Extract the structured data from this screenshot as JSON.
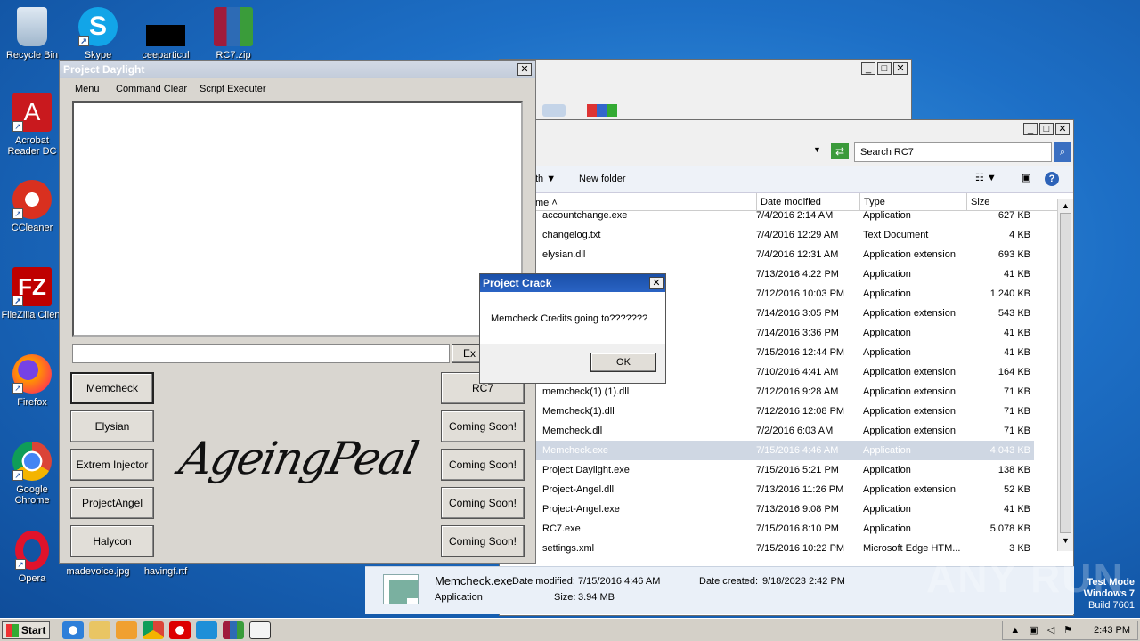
{
  "desktop_icons": [
    {
      "label": "Recycle Bin",
      "icon": "recycle-bin-icon"
    },
    {
      "label": "Skype",
      "icon": "skype-icon"
    },
    {
      "label": "ceeparticul",
      "icon": "file-icon"
    },
    {
      "label": "RC7.zip",
      "icon": "winrar-icon"
    },
    {
      "label": "Acrobat Reader DC",
      "icon": "acrobat-icon"
    },
    {
      "label": "CCleaner",
      "icon": "ccleaner-icon"
    },
    {
      "label": "FileZilla Client",
      "icon": "filezilla-icon"
    },
    {
      "label": "Firefox",
      "icon": "firefox-icon"
    },
    {
      "label": "Google Chrome",
      "icon": "chrome-icon"
    },
    {
      "label": "Opera",
      "icon": "opera-icon"
    },
    {
      "label": "madevoice.jpg",
      "icon": "image-file-icon"
    },
    {
      "label": "havingf.rtf",
      "icon": "rtf-file-icon"
    }
  ],
  "daylight": {
    "title": "Project Daylight",
    "menu": [
      "Menu",
      "Command Clear",
      "Script Executer"
    ],
    "execute_label": "Ex",
    "left_buttons": [
      "Memcheck",
      "Elysian",
      "Extrem Injector",
      "ProjectAngel",
      "Halycon"
    ],
    "right_buttons": [
      "RC7",
      "Coming Soon!",
      "Coming Soon!",
      "Coming Soon!",
      "Coming Soon!"
    ],
    "logo_text": "AgeingPeal"
  },
  "explorer": {
    "search_placeholder": "Search RC7",
    "toolbar_share": "th",
    "new_folder": "New folder",
    "columns": [
      "me",
      "Date modified",
      "Type",
      "Size"
    ],
    "files": [
      {
        "name": "accountchange.exe",
        "date": "7/4/2016 2:14 AM",
        "type": "Application",
        "size": "627 KB"
      },
      {
        "name": "changelog.txt",
        "date": "7/4/2016 12:29 AM",
        "type": "Text Document",
        "size": "4 KB"
      },
      {
        "name": "elysian.dll",
        "date": "7/4/2016 12:31 AM",
        "type": "Application extension",
        "size": "693 KB"
      },
      {
        "name": "",
        "date": "7/13/2016 4:22 PM",
        "type": "Application",
        "size": "41 KB"
      },
      {
        "name": "",
        "date": "7/12/2016 10:03 PM",
        "type": "Application",
        "size": "1,240 KB"
      },
      {
        "name": "",
        "date": "7/14/2016 3:05 PM",
        "type": "Application extension",
        "size": "543 KB"
      },
      {
        "name": "",
        "date": "7/14/2016 3:36 PM",
        "type": "Application",
        "size": "41 KB"
      },
      {
        "name": "",
        "date": "7/15/2016 12:44 PM",
        "type": "Application",
        "size": "41 KB"
      },
      {
        "name": "",
        "date": "7/10/2016 4:41 AM",
        "type": "Application extension",
        "size": "164 KB"
      },
      {
        "name": "memcheck(1) (1).dll",
        "date": "7/12/2016 9:28 AM",
        "type": "Application extension",
        "size": "71 KB"
      },
      {
        "name": "Memcheck(1).dll",
        "date": "7/12/2016 12:08 PM",
        "type": "Application extension",
        "size": "71 KB"
      },
      {
        "name": "Memcheck.dll",
        "date": "7/2/2016 6:03 AM",
        "type": "Application extension",
        "size": "71 KB"
      },
      {
        "name": "Memcheck.exe",
        "date": "7/15/2016 4:46 AM",
        "type": "Application",
        "size": "4,043 KB"
      },
      {
        "name": "Project Daylight.exe",
        "date": "7/15/2016 5:21 PM",
        "type": "Application",
        "size": "138 KB"
      },
      {
        "name": "Project-Angel.dll",
        "date": "7/13/2016 11:26 PM",
        "type": "Application extension",
        "size": "52 KB"
      },
      {
        "name": "Project-Angel.exe",
        "date": "7/13/2016 9:08 PM",
        "type": "Application",
        "size": "41 KB"
      },
      {
        "name": "RC7.exe",
        "date": "7/15/2016 8:10 PM",
        "type": "Application",
        "size": "5,078 KB"
      },
      {
        "name": "settings.xml",
        "date": "7/15/2016 10:22 PM",
        "type": "Microsoft Edge HTM...",
        "size": "3 KB"
      }
    ],
    "details": {
      "name": "Memcheck.exe",
      "type": "Application",
      "modified_label": "Date modified:",
      "modified": "7/15/2016 4:46 AM",
      "size_label": "Size:",
      "size": "3.94 MB",
      "created_label": "Date created:",
      "created": "9/18/2023 2:42 PM"
    }
  },
  "dialog": {
    "title": "Project Crack",
    "message": "Memcheck Credits going to???????",
    "ok": "OK"
  },
  "taskbar": {
    "start": "Start",
    "clock": "2:43 PM"
  },
  "watermark": {
    "line1": "Test Mode",
    "line2": "Windows 7",
    "line3": "Build 7601",
    "brand": "ANY RUN"
  }
}
